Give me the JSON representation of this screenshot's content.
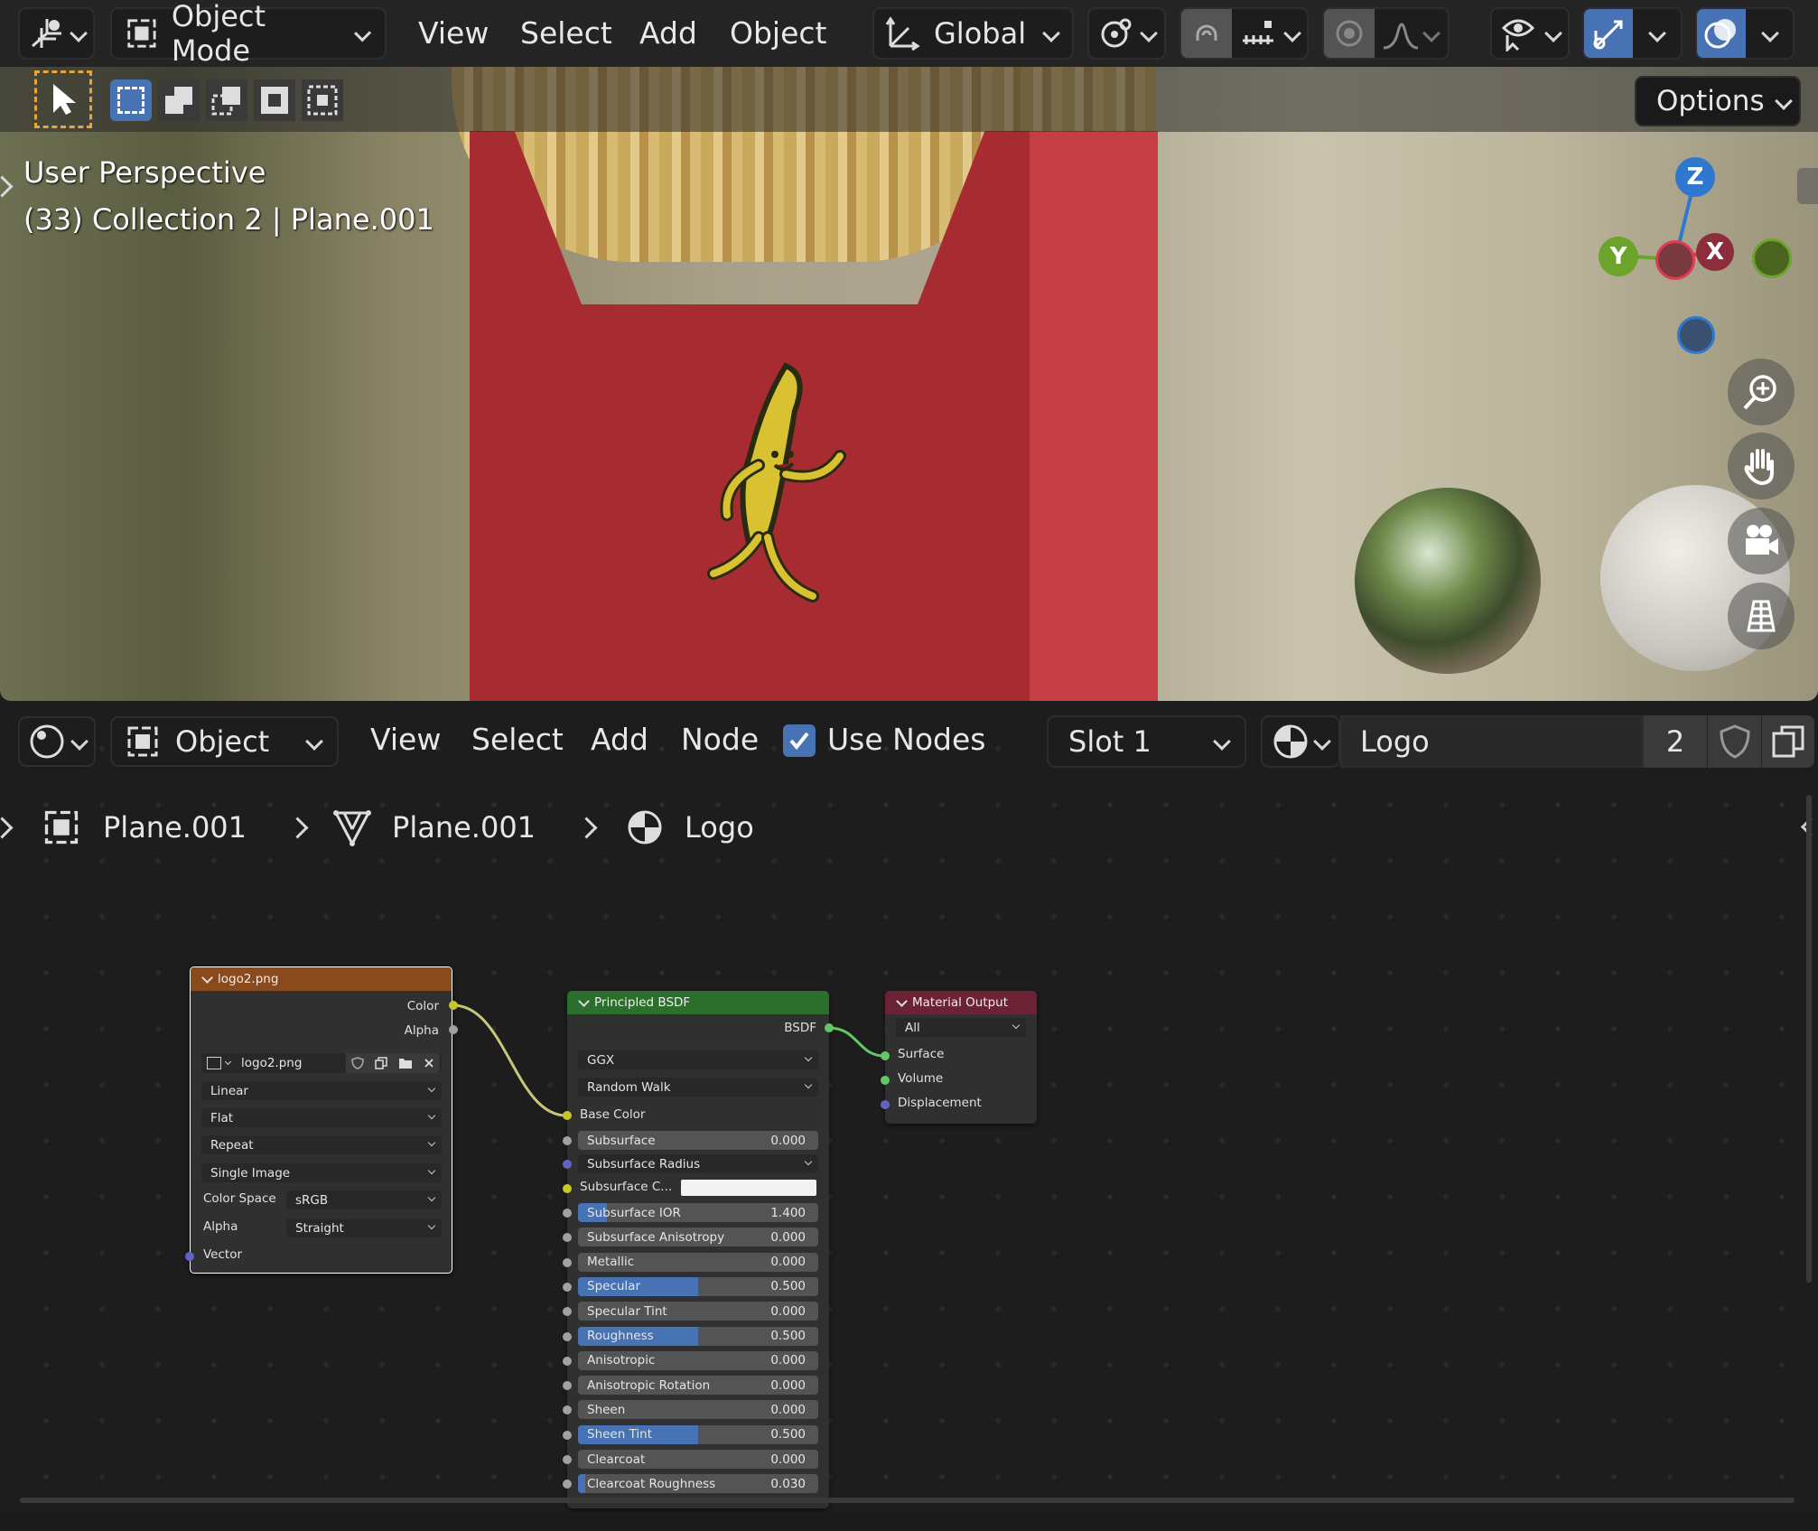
{
  "viewport_header": {
    "mode": "Object Mode",
    "menu": [
      "View",
      "Select",
      "Add",
      "Object"
    ],
    "orientation": "Global",
    "options": "Options"
  },
  "viewport_overlay": {
    "view_name": "User Perspective",
    "collection": "(33) Collection 2 | Plane.001"
  },
  "gizmo": {
    "z": "Z",
    "y": "Y",
    "x": "X"
  },
  "node_header": {
    "mode": "Object",
    "menu": [
      "View",
      "Select",
      "Add",
      "Node"
    ],
    "use_nodes": "Use Nodes",
    "slot": "Slot 1",
    "material": "Logo",
    "users": "2"
  },
  "breadcrumb": [
    "Plane.001",
    "Plane.001",
    "Logo"
  ],
  "image_node": {
    "title": "logo2.png",
    "outputs": [
      "Color",
      "Alpha"
    ],
    "image": "logo2.png",
    "interpolation": "Linear",
    "projection": "Flat",
    "extension": "Repeat",
    "source": "Single Image",
    "color_space_label": "Color Space",
    "color_space": "sRGB",
    "alpha_label": "Alpha",
    "alpha": "Straight",
    "input": "Vector"
  },
  "bsdf_node": {
    "title": "Principled BSDF",
    "output": "BSDF",
    "distribution": "GGX",
    "subsurface_method": "Random Walk",
    "base_color": "Base Color",
    "subsurface_color_label": "Subsurface C...",
    "subsurface_radius": "Subsurface Radius",
    "params": [
      {
        "label": "Subsurface",
        "value": "0.000",
        "fill": 0
      },
      {
        "label": "Subsurface IOR",
        "value": "1.400",
        "fill": 0.12
      },
      {
        "label": "Subsurface Anisotropy",
        "value": "0.000",
        "fill": 0
      },
      {
        "label": "Metallic",
        "value": "0.000",
        "fill": 0
      },
      {
        "label": "Specular",
        "value": "0.500",
        "fill": 0.5
      },
      {
        "label": "Specular Tint",
        "value": "0.000",
        "fill": 0
      },
      {
        "label": "Roughness",
        "value": "0.500",
        "fill": 0.5
      },
      {
        "label": "Anisotropic",
        "value": "0.000",
        "fill": 0
      },
      {
        "label": "Anisotropic Rotation",
        "value": "0.000",
        "fill": 0
      },
      {
        "label": "Sheen",
        "value": "0.000",
        "fill": 0
      },
      {
        "label": "Sheen Tint",
        "value": "0.500",
        "fill": 0.5
      },
      {
        "label": "Clearcoat",
        "value": "0.000",
        "fill": 0
      },
      {
        "label": "Clearcoat Roughness",
        "value": "0.030",
        "fill": 0.03
      }
    ]
  },
  "output_node": {
    "title": "Material Output",
    "target": "All",
    "inputs": [
      "Surface",
      "Volume",
      "Displacement"
    ]
  },
  "colors": {
    "accent": "#4772b3",
    "image_header": "#8b4a1c",
    "bsdf_header": "#2c6e2c",
    "output_header": "#6b2234"
  }
}
